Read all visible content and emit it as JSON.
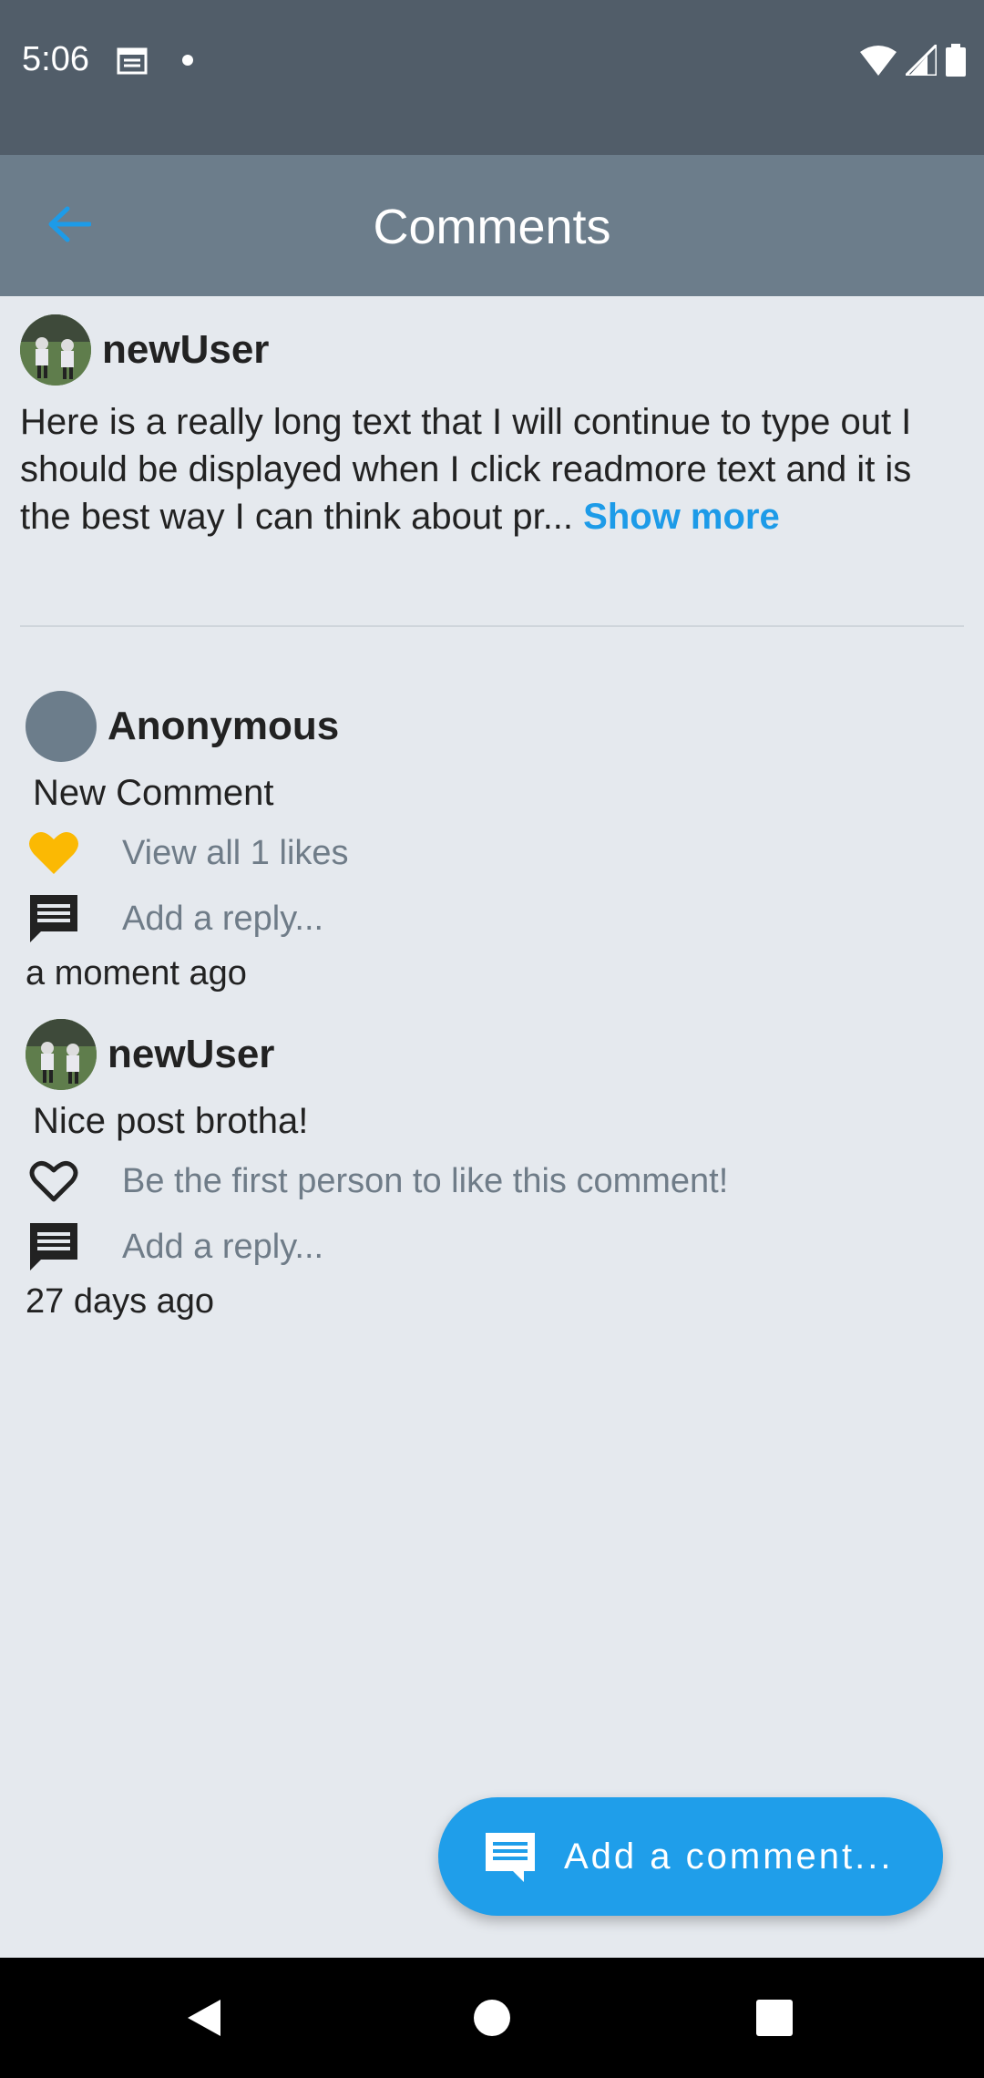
{
  "status_bar": {
    "time": "5:06",
    "icons": [
      "calendar-icon",
      "dot-icon",
      "wifi-icon",
      "signal-icon",
      "battery-icon"
    ]
  },
  "app_bar": {
    "title": "Comments",
    "back_icon": "arrow-back-icon",
    "accent": "#1d9be8",
    "background": "#6c7d8b"
  },
  "post": {
    "username": "newUser",
    "text": "Here is a really long text that I will continue to type out I should be displayed when I click readmore text and it is the best way I can think about pr... ",
    "show_more": "Show more"
  },
  "comments": [
    {
      "username": "Anonymous",
      "text": "New Comment",
      "likes_text": "View all 1 likes",
      "liked": true,
      "reply_text": "Add a reply...",
      "time": "a moment ago"
    },
    {
      "username": "newUser",
      "text": "Nice post brotha!",
      "likes_text": "Be the first person to like this comment!",
      "liked": false,
      "reply_text": "Add a reply...",
      "time": "27 days ago"
    }
  ],
  "fab": {
    "label": "Add a comment...",
    "icon": "comment-icon",
    "color": "#1f9eea"
  },
  "nav_bar": {
    "icons": [
      "back-triangle-icon",
      "home-circle-icon",
      "recents-square-icon"
    ]
  }
}
